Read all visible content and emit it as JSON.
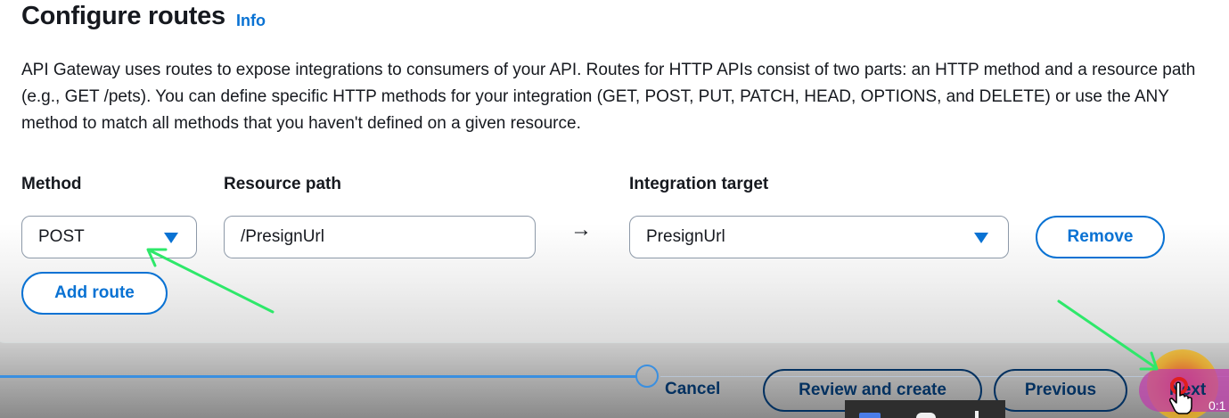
{
  "header": {
    "title": "Configure routes",
    "info_link": "Info"
  },
  "description": "API Gateway uses routes to expose integrations to consumers of your API. Routes for HTTP APIs consist of two parts: an HTTP method and a resource path (e.g., GET /pets). You can define specific HTTP methods for your integration (GET, POST, PUT, PATCH, HEAD, OPTIONS, and DELETE) or use the ANY method to match all methods that you haven't defined on a given resource.",
  "route_form": {
    "method_label": "Method",
    "resource_path_label": "Resource path",
    "integration_target_label": "Integration target",
    "method_value": "POST",
    "resource_path_value": "/PresignUrl",
    "arrow": "→",
    "integration_target_value": "PresignUrl",
    "remove_button": "Remove",
    "add_route_button": "Add route"
  },
  "footer": {
    "cancel": "Cancel",
    "review_and_create": "Review and create",
    "previous": "Previous",
    "next": "Next"
  },
  "video_overlay": {
    "timestamp": "0:1"
  },
  "colors": {
    "link_blue": "#0972d3",
    "annotation_green": "#2ee86a",
    "footer_text": "#033160"
  },
  "icons": {
    "dropdown": "caret-down-icon",
    "arrow": "right-arrow-icon",
    "cursor": "hand-pointer-icon"
  }
}
